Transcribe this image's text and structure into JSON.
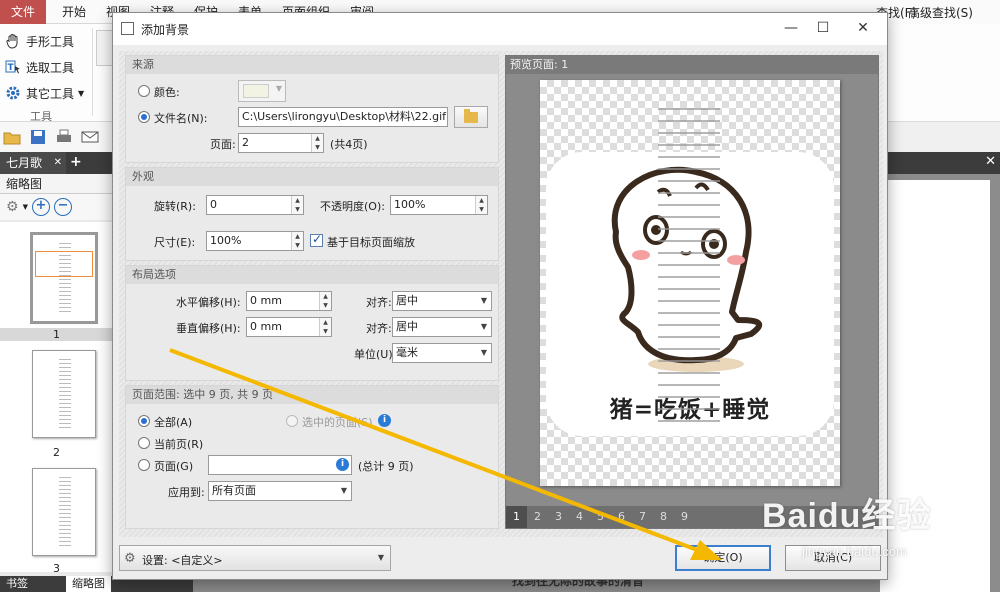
{
  "app": {
    "ribbon_tabs": [
      "文件",
      "开始",
      "视图",
      "注释",
      "保护",
      "表单",
      "页面组织",
      "审阅"
    ],
    "right_tools": [
      "查找(F)",
      "高级查找(S)"
    ],
    "tools": [
      "手形工具",
      "选取工具",
      "其它工具"
    ],
    "tools_group": "工具",
    "doc_tab": "七月歌",
    "panel_title": "缩略图",
    "thumbnails": [
      "1",
      "2",
      "3"
    ],
    "bottom_tabs": [
      "书签",
      "缩略图"
    ],
    "page_bottom_text": "找到往无际的故事的清音"
  },
  "dialog": {
    "title": "添加背景",
    "source": {
      "header": "来源",
      "color_label": "颜色:",
      "filename_label": "文件名(N):",
      "filename_value": "C:\\Users\\lirongyu\\Desktop\\材料\\22.gif",
      "page_label": "页面:",
      "page_value": "2",
      "page_total": "(共4页)"
    },
    "appearance": {
      "header": "外观",
      "rotate_label": "旋转(R):",
      "rotate_value": "0",
      "opacity_label": "不透明度(O):",
      "opacity_value": "100%",
      "size_label": "尺寸(E):",
      "size_value": "100%",
      "scale_check": "基于目标页面缩放"
    },
    "layout": {
      "header": "布局选项",
      "h_offset_label": "水平偏移(H):",
      "h_offset_value": "0 mm",
      "v_offset_label": "垂直偏移(H):",
      "v_offset_value": "0 mm",
      "align_label": "对齐:",
      "h_align_value": "居中",
      "v_align_value": "居中",
      "unit_label": "单位(U):",
      "unit_value": "毫米"
    },
    "range": {
      "header": "页面范围: 选中 9 页, 共 9 页",
      "all": "全部(A)",
      "selected": "选中的页面(S)",
      "current": "当前页(R)",
      "pages": "页面(G)",
      "pages_total": "(总计 9 页)",
      "apply_label": "应用到:",
      "apply_value": "所有页面"
    },
    "preview": {
      "header": "预览页面: 1",
      "caption": "猪=吃饭+睡觉",
      "pages": [
        "1",
        "2",
        "3",
        "4",
        "5",
        "6",
        "7",
        "8",
        "9"
      ]
    },
    "settings": "设置: <自定义>",
    "ok": "确定(O)",
    "cancel": "取消(C)"
  },
  "watermark": {
    "brand": "Baidu经验",
    "url": "jingyan.baidu.com"
  },
  "colors": {
    "accent": "#2b6fd6",
    "arrow": "#f5b800",
    "file_tab": "#c0504d"
  }
}
